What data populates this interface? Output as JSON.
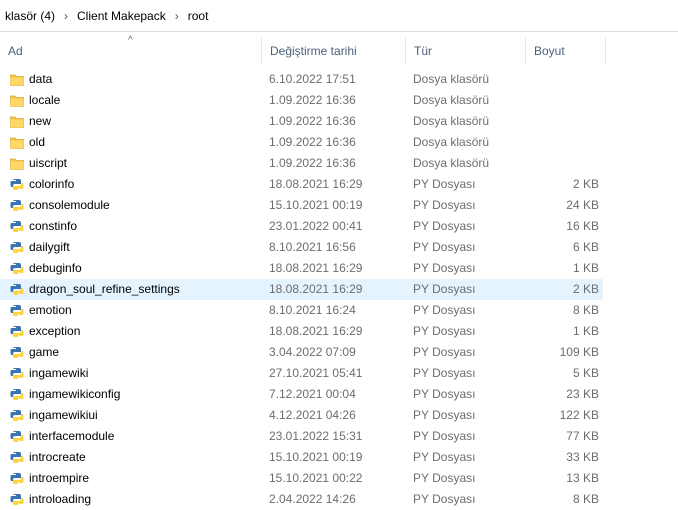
{
  "breadcrumb": [
    "klasör (4)",
    "Client Makepack",
    "root"
  ],
  "columns": {
    "name": "Ad",
    "date": "Değiştirme tarihi",
    "type": "Tür",
    "size": "Boyut"
  },
  "colors": {
    "header_text": "#4c607a",
    "selection": "#e5f3ff",
    "folder": "#f4c54a",
    "python_blue": "#3a73b0",
    "python_yellow": "#ffd33c"
  },
  "files": [
    {
      "name": "data",
      "date": "6.10.2022 17:51",
      "type": "Dosya klasörü",
      "size": "",
      "icon": "folder-icon"
    },
    {
      "name": "locale",
      "date": "1.09.2022 16:36",
      "type": "Dosya klasörü",
      "size": "",
      "icon": "folder-icon"
    },
    {
      "name": "new",
      "date": "1.09.2022 16:36",
      "type": "Dosya klasörü",
      "size": "",
      "icon": "folder-icon"
    },
    {
      "name": "old",
      "date": "1.09.2022 16:36",
      "type": "Dosya klasörü",
      "size": "",
      "icon": "folder-icon"
    },
    {
      "name": "uiscript",
      "date": "1.09.2022 16:36",
      "type": "Dosya klasörü",
      "size": "",
      "icon": "folder-icon"
    },
    {
      "name": "colorinfo",
      "date": "18.08.2021 16:29",
      "type": "PY Dosyası",
      "size": "2 KB",
      "icon": "python-file-icon"
    },
    {
      "name": "consolemodule",
      "date": "15.10.2021 00:19",
      "type": "PY Dosyası",
      "size": "24 KB",
      "icon": "python-file-icon"
    },
    {
      "name": "constinfo",
      "date": "23.01.2022 00:41",
      "type": "PY Dosyası",
      "size": "16 KB",
      "icon": "python-file-icon"
    },
    {
      "name": "dailygift",
      "date": "8.10.2021 16:56",
      "type": "PY Dosyası",
      "size": "6 KB",
      "icon": "python-file-icon"
    },
    {
      "name": "debuginfo",
      "date": "18.08.2021 16:29",
      "type": "PY Dosyası",
      "size": "1 KB",
      "icon": "python-file-icon"
    },
    {
      "name": "dragon_soul_refine_settings",
      "date": "18.08.2021 16:29",
      "type": "PY Dosyası",
      "size": "2 KB",
      "icon": "python-file-icon",
      "selected": true
    },
    {
      "name": "emotion",
      "date": "8.10.2021 16:24",
      "type": "PY Dosyası",
      "size": "8 KB",
      "icon": "python-file-icon"
    },
    {
      "name": "exception",
      "date": "18.08.2021 16:29",
      "type": "PY Dosyası",
      "size": "1 KB",
      "icon": "python-file-icon"
    },
    {
      "name": "game",
      "date": "3.04.2022 07:09",
      "type": "PY Dosyası",
      "size": "109 KB",
      "icon": "python-file-icon"
    },
    {
      "name": "ingamewiki",
      "date": "27.10.2021 05:41",
      "type": "PY Dosyası",
      "size": "5 KB",
      "icon": "python-file-icon"
    },
    {
      "name": "ingamewikiconfig",
      "date": "7.12.2021 00:04",
      "type": "PY Dosyası",
      "size": "23 KB",
      "icon": "python-file-icon"
    },
    {
      "name": "ingamewikiui",
      "date": "4.12.2021 04:26",
      "type": "PY Dosyası",
      "size": "122 KB",
      "icon": "python-file-icon"
    },
    {
      "name": "interfacemodule",
      "date": "23.01.2022 15:31",
      "type": "PY Dosyası",
      "size": "77 KB",
      "icon": "python-file-icon"
    },
    {
      "name": "introcreate",
      "date": "15.10.2021 00:19",
      "type": "PY Dosyası",
      "size": "33 KB",
      "icon": "python-file-icon"
    },
    {
      "name": "introempire",
      "date": "15.10.2021 00:22",
      "type": "PY Dosyası",
      "size": "13 KB",
      "icon": "python-file-icon"
    },
    {
      "name": "introloading",
      "date": "2.04.2022 14:26",
      "type": "PY Dosyası",
      "size": "8 KB",
      "icon": "python-file-icon"
    }
  ]
}
